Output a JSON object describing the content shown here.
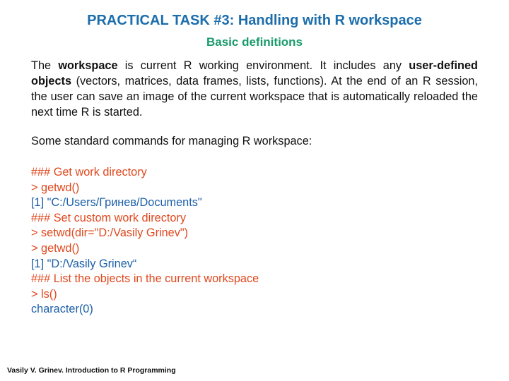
{
  "title": "PRACTICAL TASK #3: Handling with R workspace",
  "subtitle": "Basic definitions",
  "paragraph": {
    "t1": "The ",
    "b1": "workspace",
    "t2": " is current R working environment. It includes any ",
    "b2": "user-defined objects",
    "t3": " (vectors, matrices, data frames, lists, functions). At the end of an R session, the user can save an image of the current workspace that is automatically reloaded the next time R is started."
  },
  "intro": "Some standard commands for managing R workspace:",
  "code_lines": [
    {
      "type": "cmd",
      "text": "### Get work directory"
    },
    {
      "type": "cmd",
      "text": "> getwd()"
    },
    {
      "type": "out",
      "text": "[1] \"C:/Users/Гринев/Documents\""
    },
    {
      "type": "cmd",
      "text": "### Set custom work directory"
    },
    {
      "type": "cmd",
      "text": "> setwd(dir=\"D:/Vasily Grinev\")"
    },
    {
      "type": "cmd",
      "text": "> getwd()"
    },
    {
      "type": "out",
      "text": "[1] \"D:/Vasily Grinev“"
    },
    {
      "type": "cmd",
      "text": "### List the objects in the current workspace"
    },
    {
      "type": "cmd",
      "text": "> ls()"
    },
    {
      "type": "out",
      "text": "character(0)"
    }
  ],
  "footer": "Vasily V. Grinev. Introduction to R Programming",
  "colors": {
    "title": "#1b6dab",
    "subtitle": "#1a9b6b",
    "command": "#e0481e",
    "output": "#1c5fa8"
  }
}
